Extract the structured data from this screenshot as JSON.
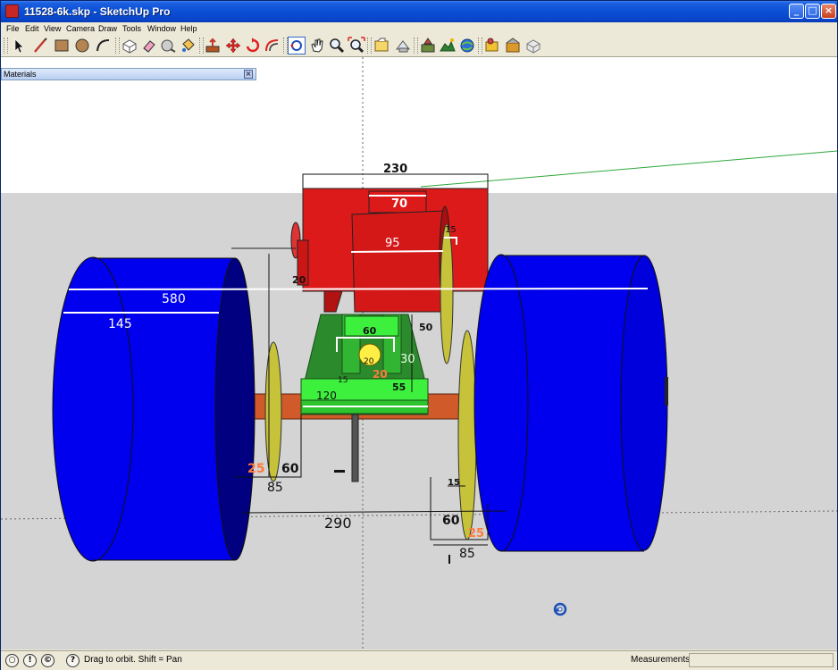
{
  "window": {
    "title": "11528-6k.skp - SketchUp Pro",
    "minimize_label": "_",
    "maximize_label": "□",
    "close_label": "×"
  },
  "menu": [
    "File",
    "Edit",
    "View",
    "Camera",
    "Draw",
    "Tools",
    "Window",
    "Help"
  ],
  "toolbar": {
    "tools": [
      "select-icon",
      "line-icon",
      "rectangle-icon",
      "circle-icon",
      "arc-icon",
      "make-component-icon",
      "eraser-icon",
      "tape-measure-icon",
      "paint-bucket-icon",
      "push-pull-icon",
      "move-icon",
      "rotate-icon",
      "offset-icon",
      "orbit-icon",
      "pan-icon",
      "zoom-icon",
      "zoom-extents-icon",
      "get-models-icon",
      "share-model-icon",
      "google-earth-snapshot-icon",
      "toggle-terrain-icon",
      "place-model-icon",
      "get-photo-texture-icon",
      "component-warehouse-icon",
      "share-component-icon",
      "extension-icon"
    ]
  },
  "materials_panel": {
    "title": "Materials",
    "close_label": "×"
  },
  "dimensions": {
    "top_width": "230",
    "cab_top": "70",
    "cab_front": "95",
    "cab_side_small": "15",
    "left_bracket": "20",
    "track_width": "580",
    "wheel_width": "145",
    "frame_mid": "60",
    "frame_side": "50",
    "hub": "20",
    "hub_orange": "20",
    "frame_right": "30",
    "frame_small": "15",
    "axle_mid": "55",
    "axle_label": "120",
    "left_orange": "25",
    "left_60": "60",
    "left_85": "85",
    "bottom_290": "290",
    "right_15": "15",
    "right_60": "60",
    "right_orange": "25",
    "right_85": "85"
  },
  "colors": {
    "sky": "#ffffff",
    "ground": "#d4d4d4",
    "wheel": "#0000ee",
    "wheel_dark": "#00006a",
    "cab": "#dd1a1a",
    "frame": "#2b8a2b",
    "frame_light": "#3ef03e",
    "axle": "#d05a2a",
    "disc": "#c6c23a"
  },
  "status": {
    "hint": "Drag to orbit.  Shift = Pan",
    "measurements_label": "Measurements",
    "measurements_value": ""
  }
}
